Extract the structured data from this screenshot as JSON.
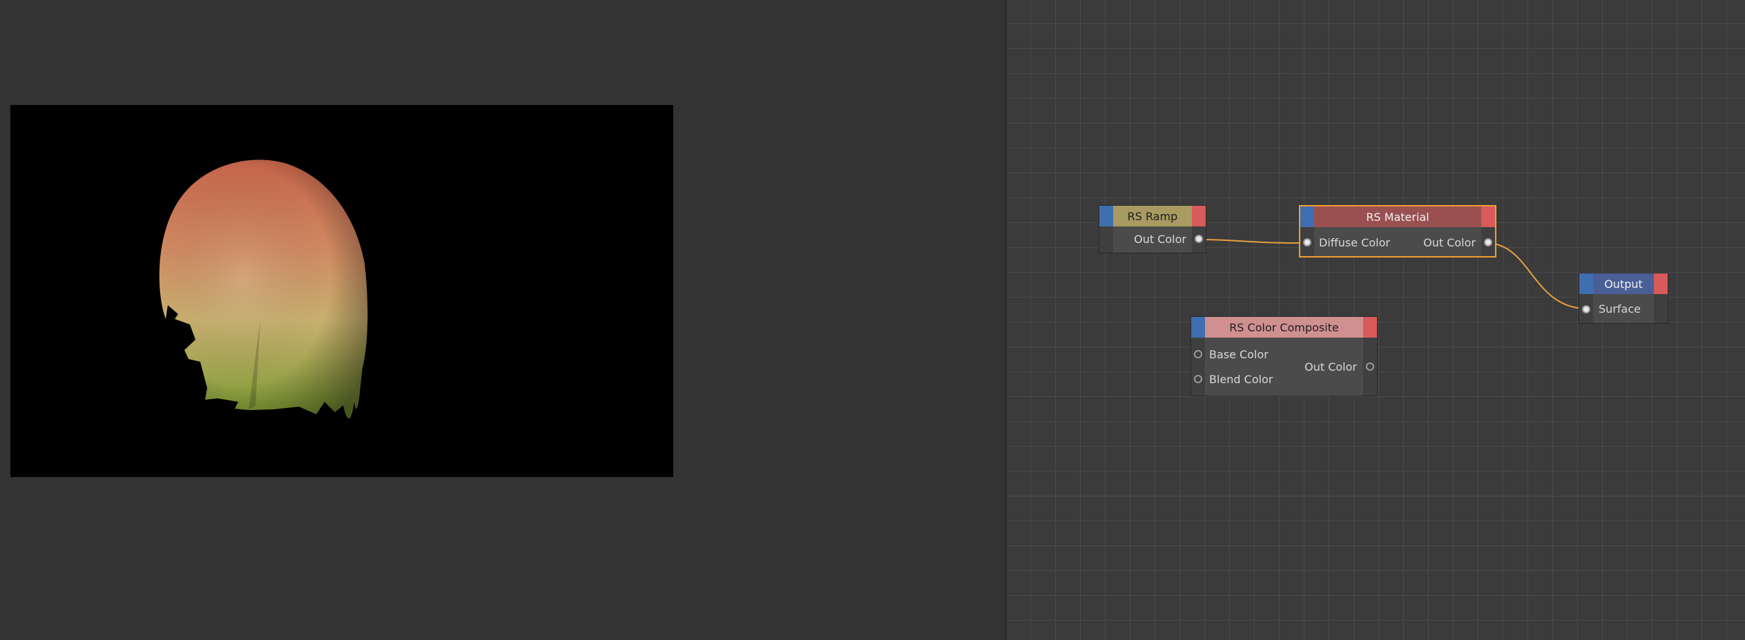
{
  "nodes": {
    "rs_ramp": {
      "title": "RS Ramp",
      "header_color": "#a89a60",
      "out_label": "Out Color"
    },
    "rs_material": {
      "title": "RS Material",
      "header_color": "#9a5050",
      "in_label": "Diffuse Color",
      "out_label": "Out Color"
    },
    "output": {
      "title": "Output",
      "header_color": "#4a5f95",
      "in_label": "Surface"
    },
    "rs_color_composite": {
      "title": "RS Color Composite",
      "header_color": "#d09090",
      "in_label_1": "Base Color",
      "in_label_2": "Blend Color",
      "out_label": "Out Color"
    }
  },
  "colors": {
    "wire": "#e8a040",
    "selection": "#f0a030",
    "input_tab": "#3f6fb0",
    "output_tab": "#d85a5a",
    "render_background": "#000000"
  }
}
